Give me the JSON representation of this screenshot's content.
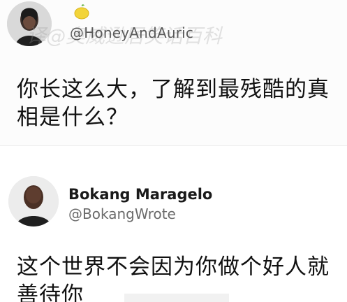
{
  "tweets": [
    {
      "handle": "@HoneyAndAuric",
      "text": "你长这么大，了解到最残酷的真相是什么？",
      "watermark": "译@奥威逊居笑话百科",
      "emoji": "lemon-icon"
    },
    {
      "name": "Bokang Maragelo",
      "handle": "@BokangWrote",
      "text": "这个世界不会因为你做个好人就善待你"
    }
  ],
  "colors": {
    "text": "#111111",
    "handle": "#6b6b6b",
    "background": "#ffffff"
  }
}
